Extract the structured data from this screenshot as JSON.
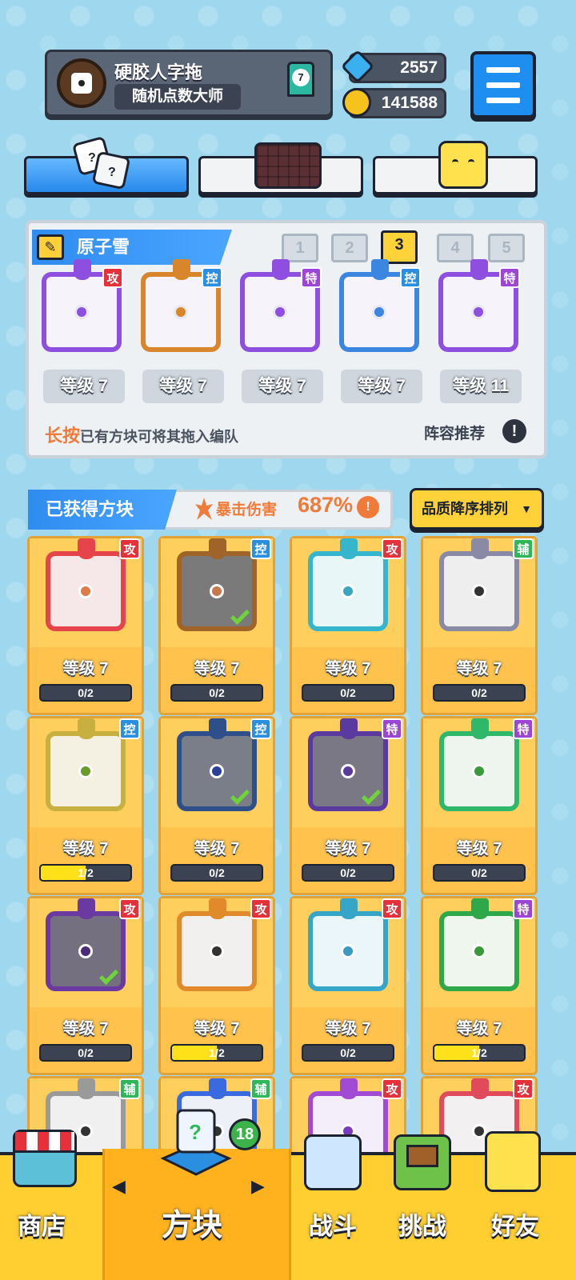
{
  "profile": {
    "name": "硬胶人字拖",
    "title": "随机点数大师",
    "rank": "7"
  },
  "currency": {
    "gems": "2557",
    "coins": "141588"
  },
  "deck": {
    "name": "原子雪",
    "slots": [
      "1",
      "2",
      "3",
      "4",
      "5"
    ],
    "active_slot": 3,
    "tiles": [
      {
        "tag": "攻",
        "type": "atk",
        "color": "#8e4fe0",
        "level": "等级 7"
      },
      {
        "tag": "控",
        "type": "ctl",
        "color": "#d9852c",
        "level": "等级 7"
      },
      {
        "tag": "特",
        "type": "spc",
        "color": "#8e4fe0",
        "level": "等级 7"
      },
      {
        "tag": "控",
        "type": "ctl",
        "color": "#3b86e0",
        "level": "等级 7"
      },
      {
        "tag": "特",
        "type": "spc",
        "color": "#8e4fe0",
        "level": "等级 11"
      }
    ],
    "hint_highlight": "长按",
    "hint_text": "已有方块可将其拖入编队",
    "recommend": "阵容推荐",
    "recommend_icon": "!"
  },
  "owned": {
    "label": "已获得方块",
    "crit_label": "暴击伤害",
    "crit_value": "687%",
    "crit_icon": "!",
    "sort_label": "品质降序排列",
    "sort_caret": "▼",
    "cards": [
      {
        "tag": "攻",
        "type": "atk",
        "color": "#e5444a",
        "bg": "#f6e8e8",
        "dot": "#e07a46",
        "level": "等级 7",
        "progress_text": "0/2",
        "progress": 0,
        "check": false
      },
      {
        "tag": "控",
        "type": "ctl",
        "color": "#a06428",
        "bg": "#7a7a7a",
        "dot": "#c8784a",
        "level": "等级 7",
        "progress_text": "0/2",
        "progress": 0,
        "check": true
      },
      {
        "tag": "攻",
        "type": "atk",
        "color": "#36b6cc",
        "bg": "#e8f6f8",
        "dot": "#3aa7bf",
        "level": "等级 7",
        "progress_text": "0/2",
        "progress": 0,
        "check": false
      },
      {
        "tag": "辅",
        "type": "sup",
        "color": "#8a8aa6",
        "bg": "#eeeeef",
        "dot": "#333333",
        "level": "等级 7",
        "progress_text": "0/2",
        "progress": 0,
        "check": false
      },
      {
        "tag": "控",
        "type": "ctl",
        "color": "#c8b040",
        "bg": "#f5f1e2",
        "dot": "#6a9a2a",
        "level": "等级 7",
        "progress_text": "1/2",
        "progress": 0.5,
        "check": false
      },
      {
        "tag": "控",
        "type": "ctl",
        "color": "#2e4f8a",
        "bg": "#7a7e88",
        "dot": "#2a3e9a",
        "level": "等级 7",
        "progress_text": "0/2",
        "progress": 0,
        "check": true
      },
      {
        "tag": "特",
        "type": "spc",
        "color": "#5b3aa0",
        "bg": "#7a7884",
        "dot": "#5b3aa0",
        "level": "等级 7",
        "progress_text": "0/2",
        "progress": 0,
        "check": true
      },
      {
        "tag": "特",
        "type": "spc",
        "color": "#2fb86a",
        "bg": "#eef5ef",
        "dot": "#3a9a3a",
        "level": "等级 7",
        "progress_text": "0/2",
        "progress": 0,
        "check": false
      },
      {
        "tag": "攻",
        "type": "atk",
        "color": "#6a3aa0",
        "bg": "#747080",
        "dot": "#4a2a7a",
        "level": "等级 7",
        "progress_text": "0/2",
        "progress": 0,
        "check": true
      },
      {
        "tag": "攻",
        "type": "atk",
        "color": "#e08a2c",
        "bg": "#f2f0ee",
        "dot": "#333333",
        "level": "等级 7",
        "progress_text": "1/2",
        "progress": 0.5,
        "check": false
      },
      {
        "tag": "攻",
        "type": "atk",
        "color": "#36a6c8",
        "bg": "#eaf6fa",
        "dot": "#3a9ac2",
        "level": "等级 7",
        "progress_text": "0/2",
        "progress": 0,
        "check": false
      },
      {
        "tag": "特",
        "type": "spc",
        "color": "#2fa84a",
        "bg": "#eef6ee",
        "dot": "#3a9a3a",
        "level": "等级 7",
        "progress_text": "1/2",
        "progress": 0.5,
        "check": false
      },
      {
        "tag": "辅",
        "type": "sup",
        "color": "#9a9a9a",
        "bg": "#f0f0f0",
        "dot": "#333333",
        "level": "",
        "progress_text": "",
        "progress": 0,
        "check": false
      },
      {
        "tag": "辅",
        "type": "sup",
        "color": "#3a6ae0",
        "bg": "#eef0f8",
        "dot": "#333333",
        "level": "",
        "progress_text": "",
        "progress": 0,
        "check": false
      },
      {
        "tag": "攻",
        "type": "atk",
        "color": "#a04ad6",
        "bg": "#f3eefa",
        "dot": "#7a3ac0",
        "level": "",
        "progress_text": "",
        "progress": 0,
        "check": false
      },
      {
        "tag": "攻",
        "type": "atk",
        "color": "#e04a5a",
        "bg": "#f2f0f0",
        "dot": "#333333",
        "level": "",
        "progress_text": "",
        "progress": 0,
        "check": false
      }
    ]
  },
  "nav": {
    "shop": "商店",
    "blocks": "方块",
    "battle": "战斗",
    "challenge": "挑战",
    "friends": "好友",
    "blocks_badge": "18",
    "left_arrow": "◀",
    "right_arrow": "▶"
  }
}
